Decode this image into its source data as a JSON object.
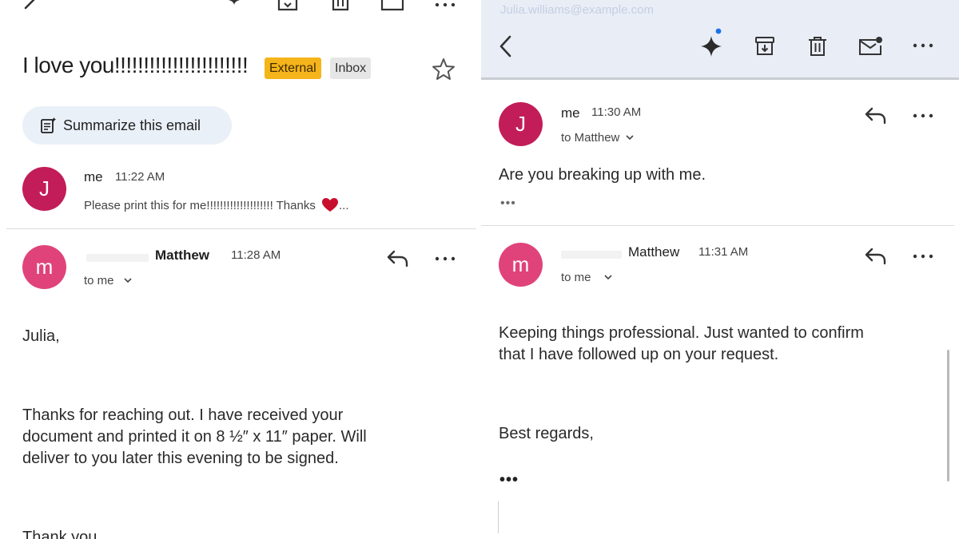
{
  "left": {
    "subject": "I love you!!!!!!!!!!!!!!!!!!!!!!!",
    "labels": [
      "External",
      "Inbox"
    ],
    "summarize_label": "Summarize this email",
    "first_message": {
      "avatar": "J",
      "sender": "me",
      "time": "11:22 AM",
      "snippet": "Please print this for me!!!!!!!!!!!!!!!!!!!! Thanks",
      "snippet_suffix": "..."
    },
    "second_message": {
      "avatar": "m",
      "sender": "Matthew",
      "time": "11:28 AM",
      "recipient": "to me",
      "greeting": "Julia,",
      "paragraph": [
        "Thanks for reaching out. I have received your",
        "document and printed it on 8 ½″ x 11″ paper. Will",
        "deliver to you later this evening to be signed."
      ],
      "closing_cropped": "Thank you"
    }
  },
  "right": {
    "cropped_link": "Julia.williams@example.com",
    "first_message": {
      "avatar": "J",
      "sender": "me",
      "time": "11:30 AM",
      "recipient": "to Matthew",
      "body": "Are you breaking up with me.",
      "more": "•••"
    },
    "second_message": {
      "avatar": "m",
      "sender": "Matthew",
      "time": "11:31 AM",
      "recipient": "to me",
      "paragraph": [
        "Keeping things professional. Just wanted to confirm",
        "that I have followed up on your request."
      ],
      "closing": "Best regards,",
      "more": "•••"
    }
  },
  "icons": {
    "back": "chevron-left-icon",
    "gemini": "sparkle-icon",
    "archive": "archive-icon",
    "delete": "trash-icon",
    "mark_unread": "mail-unread-icon",
    "more": "more-horizontal-icon",
    "star": "star-icon",
    "reply": "reply-icon",
    "summarize": "summarize-doc-icon",
    "heart": "heart-emoji-icon"
  },
  "colors": {
    "external_chip": "#f6b41b",
    "inbox_chip": "#e6e6e6",
    "avatar_me": "#c21d58",
    "avatar_matthew": "#e0437a",
    "toolbar_bg": "#e9edf6",
    "gemini_dot": "#1a73e8",
    "heart": "#c8102e"
  }
}
